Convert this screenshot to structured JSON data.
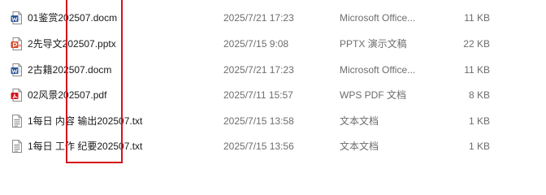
{
  "files": [
    {
      "name": "01鉴赏202507.docm",
      "date": "2025/7/21 17:23",
      "type": "Microsoft Office...",
      "size": "11 KB",
      "icon": "word-doc-icon"
    },
    {
      "name": "2先导文202507.pptx",
      "date": "2025/7/15 9:08",
      "type": "PPTX 演示文稿",
      "size": "22 KB",
      "icon": "powerpoint-icon"
    },
    {
      "name": "2古籍202507.docm",
      "date": "2025/7/21 17:23",
      "type": "Microsoft Office...",
      "size": "11 KB",
      "icon": "word-doc-icon"
    },
    {
      "name": "02风景202507.pdf",
      "date": "2025/7/11 15:57",
      "type": "WPS PDF 文档",
      "size": "8 KB",
      "icon": "pdf-icon"
    },
    {
      "name": "1每日 内容 输出202507.txt",
      "date": "2025/7/15 13:58",
      "type": "文本文档",
      "size": "1 KB",
      "icon": "text-file-icon"
    },
    {
      "name": "1每日 工作 纪要202507.txt",
      "date": "2025/7/15 13:56",
      "type": "文本文档",
      "size": "1 KB",
      "icon": "text-file-icon"
    }
  ],
  "colors": {
    "highlight_border": "#d5121b",
    "word_blue": "#2b5797",
    "powerpoint_orange": "#d24726",
    "pdf_red": "#d5121b"
  }
}
